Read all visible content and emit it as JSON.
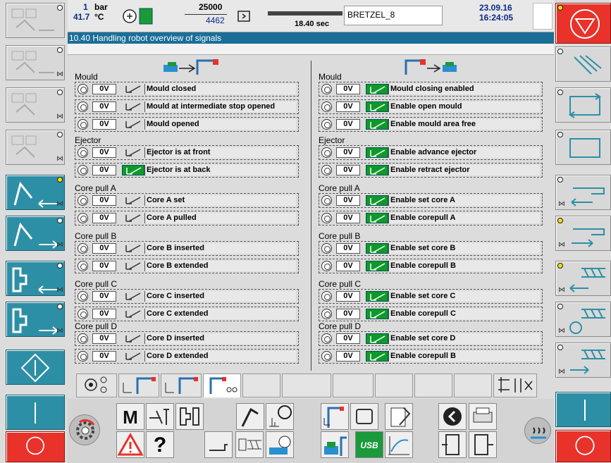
{
  "header": {
    "pressure_value": "1",
    "pressure_unit": "bar",
    "temp_value": "41.7",
    "temp_unit": "°C",
    "counter_target": "25000",
    "counter_actual": "4462",
    "cycle_time": "18.40 sec",
    "mould_name": "BRETZEL_8",
    "date": "23.09.16",
    "time": "16:24:05",
    "page_title": "10.40 Handling robot overview of signals"
  },
  "left": {
    "title": "Mould",
    "sections": [
      {
        "title": "Mould",
        "rows": [
          {
            "voltage": "0V",
            "label": "Mould closed",
            "active": false
          },
          {
            "voltage": "0V",
            "label": "Mould at intermediate stop opened",
            "active": false
          },
          {
            "voltage": "0V",
            "label": "Mould opened",
            "active": false
          }
        ]
      },
      {
        "title": "Ejector",
        "rows": [
          {
            "voltage": "0V",
            "label": "Ejector is at front",
            "active": false
          },
          {
            "voltage": "0V",
            "label": "Ejector is at back",
            "active": true
          }
        ]
      },
      {
        "title": "Core pull A",
        "rows": [
          {
            "voltage": "0V",
            "label": "Core A set",
            "active": false
          },
          {
            "voltage": "0V",
            "label": "Core A pulled",
            "active": false
          }
        ]
      },
      {
        "title": "Core pull B",
        "rows": [
          {
            "voltage": "0V",
            "label": "Core B inserted",
            "active": false
          },
          {
            "voltage": "0V",
            "label": "Core B extended",
            "active": false
          }
        ]
      },
      {
        "title": "Core pull C",
        "rows": [
          {
            "voltage": "0V",
            "label": "Core C inserted",
            "active": false
          },
          {
            "voltage": "0V",
            "label": "Core C extended",
            "active": false
          }
        ]
      },
      {
        "title": "Core pull D",
        "rows": [
          {
            "voltage": "0V",
            "label": "Core D inserted",
            "active": false
          },
          {
            "voltage": "0V",
            "label": "Core D extended",
            "active": false
          }
        ]
      }
    ]
  },
  "right": {
    "sections": [
      {
        "title": "Mould",
        "rows": [
          {
            "voltage": "0V",
            "label": "Mould closing enabled",
            "active": true
          },
          {
            "voltage": "0V",
            "label": "Enable open mould",
            "active": true
          },
          {
            "voltage": "0V",
            "label": "Enable mould area free",
            "active": true
          }
        ]
      },
      {
        "title": "Ejector",
        "rows": [
          {
            "voltage": "0V",
            "label": "Enable advance ejector",
            "active": true
          },
          {
            "voltage": "0V",
            "label": "Enable retract ejector",
            "active": true
          }
        ]
      },
      {
        "title": "Core pull A",
        "rows": [
          {
            "voltage": "0V",
            "label": "Enable set core A",
            "active": true
          },
          {
            "voltage": "0V",
            "label": "Enable corepull A",
            "active": true
          }
        ]
      },
      {
        "title": "Core pull B",
        "rows": [
          {
            "voltage": "0V",
            "label": "Enable set core B",
            "active": true
          },
          {
            "voltage": "0V",
            "label": "Enable corepull B",
            "active": true
          }
        ]
      },
      {
        "title": "Core pull C",
        "rows": [
          {
            "voltage": "0V",
            "label": "Enable set core C",
            "active": true
          },
          {
            "voltage": "0V",
            "label": "Enable corepull C",
            "active": true
          }
        ]
      },
      {
        "title": "Core pull D",
        "rows": [
          {
            "voltage": "0V",
            "label": "Enable set core D",
            "active": true
          },
          {
            "voltage": "0V",
            "label": "Enable corepull B",
            "active": true
          }
        ]
      }
    ]
  },
  "bottom_menu": {
    "m_label": "M",
    "help_label": "?",
    "usb_label": "USB"
  },
  "colors": {
    "title_bar": "#1a6e98",
    "key_blue": "#2d8fa6",
    "active_green": "#0e9a2a",
    "stop_red": "#e8322a"
  }
}
